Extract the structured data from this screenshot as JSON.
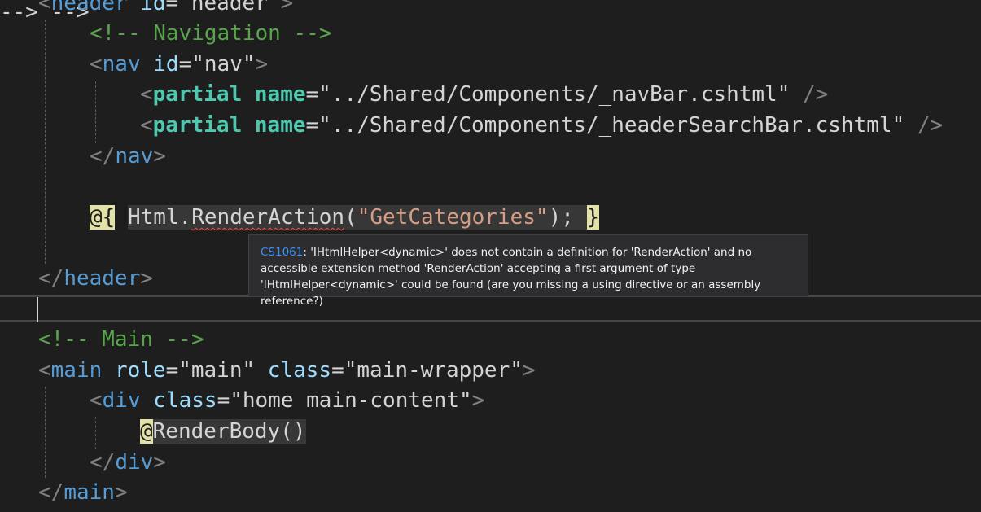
{
  "editor": {
    "lines": {
      "header_open": {
        "lt": "<",
        "tag": "header",
        "attr": "id",
        "eq": "=",
        "val": "\"header\"",
        "gt": ">"
      },
      "nav_comment": "<!-- Navigation -->",
      "nav_open": {
        "lt": "<",
        "tag": "nav",
        "attr": "id",
        "eq": "=",
        "val": "\"nav\"",
        "gt": ">"
      },
      "partial1": {
        "lt": "<",
        "tag": "partial",
        "attr": "name",
        "eq": "=",
        "val": "\"../Shared/Components/_navBar.cshtml\"",
        "close": "/>"
      },
      "partial2": {
        "lt": "<",
        "tag": "partial",
        "attr": "name",
        "eq": "=",
        "val": "\"../Shared/Components/_headerSearchBar.cshtml\"",
        "close": "/>"
      },
      "nav_close": {
        "lt": "</",
        "tag": "nav",
        "gt": ">"
      },
      "razor_call": {
        "open": "@{",
        "obj": "Html",
        "dot": ".",
        "method": "RenderAction",
        "paren_open": "(",
        "arg": "\"GetCategories\"",
        "paren_close": ");",
        "close": "}"
      },
      "header_close": {
        "lt": "</",
        "tag": "header",
        "gt": ">"
      },
      "main_comment": "<!-- Main -->",
      "main_open": {
        "lt": "<",
        "tag": "main",
        "attr1": "role",
        "eq": "=",
        "val1": "\"main\"",
        "attr2": "class",
        "val2": "\"main-wrapper\"",
        "gt": ">"
      },
      "div_open": {
        "lt": "<",
        "tag": "div",
        "attr": "class",
        "eq": "=",
        "val": "\"home main-content\"",
        "gt": ">"
      },
      "render_body": {
        "at": "@",
        "method": "RenderBody",
        "parens": "()"
      },
      "div_close": {
        "lt": "</",
        "tag": "div",
        "gt": ">"
      },
      "main_close": {
        "lt": "</",
        "tag": "main",
        "gt": ">"
      }
    }
  },
  "tooltip": {
    "code": "CS1061",
    "message": ": 'IHtmlHelper<dynamic>' does not contain a definition for 'RenderAction' and no accessible extension method 'RenderAction' accepting a first argument of type 'IHtmlHelper<dynamic>' could be found (are you missing a using directive or an assembly reference?)"
  },
  "colors": {
    "background": "#1e1e1e",
    "tag": "#569cd6",
    "component": "#4ec9b0",
    "attribute": "#9cdcfe",
    "comment": "#57a64a",
    "csharp_string": "#d69d85",
    "razor_transition": "#e1e1a8",
    "error_squiggle": "#f14c4c",
    "tooltip_code": "#3794ff"
  }
}
